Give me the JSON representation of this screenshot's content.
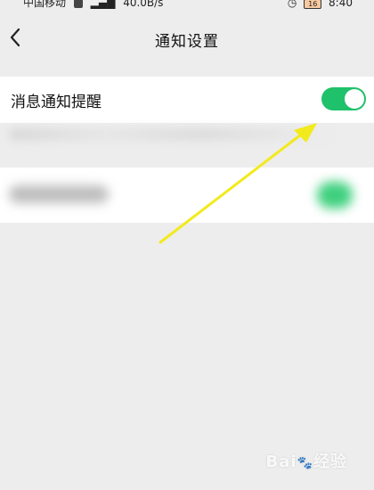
{
  "status_bar": {
    "carrier": "中国移动",
    "speed": "40.0B/s",
    "time": "8:40",
    "battery": "16"
  },
  "header": {
    "title": "通知设置",
    "back_icon": "chevron-left-icon"
  },
  "settings": {
    "message_notification_label": "消息通知提醒",
    "message_notification_enabled": true,
    "accent_color": "#1fc16a"
  },
  "watermark": "Bai 经验"
}
